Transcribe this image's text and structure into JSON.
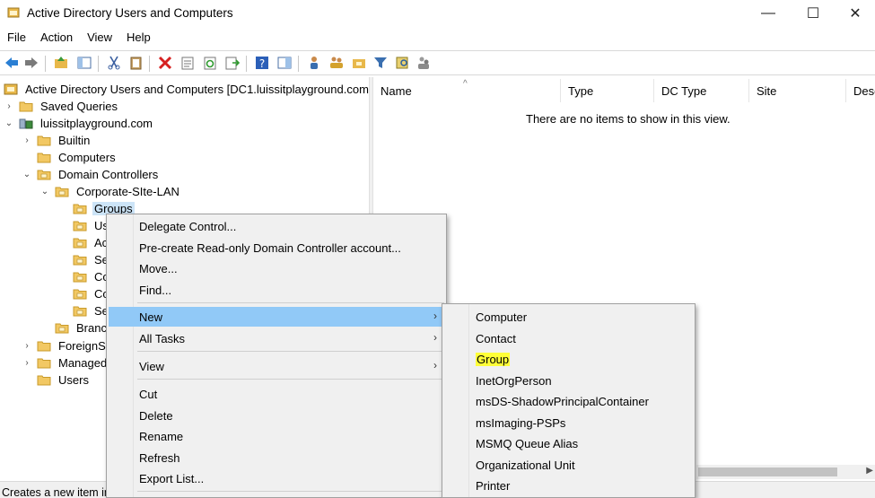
{
  "window": {
    "title": "Active Directory Users and Computers",
    "minimize": "—",
    "maximize": "☐",
    "close": "✕"
  },
  "menubar": [
    "File",
    "Action",
    "View",
    "Help"
  ],
  "tree": {
    "root": "Active Directory Users and Computers [DC1.luissitplayground.com]",
    "saved_queries": "Saved Queries",
    "domain": "luissitplayground.com",
    "builtin": "Builtin",
    "computers": "Computers",
    "domain_controllers": "Domain Controllers",
    "corporate_site": "Corporate-SIte-LAN",
    "groups": "Groups",
    "child_u": "Us",
    "child_a": "Ac",
    "child_s1": "Se",
    "child_c1": "Co",
    "child_c2": "Co",
    "child_s2": "Se",
    "branch": "Branc",
    "foreign": "ForeignSe",
    "managed": "Managed",
    "users": "Users"
  },
  "list": {
    "columns": [
      "Name",
      "Type",
      "DC Type",
      "Site",
      "Desc"
    ],
    "empty_message": "There are no items to show in this view.",
    "sort_glyph": "^"
  },
  "status": "Creates a new item in",
  "context_menu": {
    "items": [
      "Delegate Control...",
      "Pre-create Read-only Domain Controller account...",
      "Move...",
      "Find...",
      "New",
      "All Tasks",
      "View",
      "Cut",
      "Delete",
      "Rename",
      "Refresh",
      "Export List..."
    ],
    "submenu_arrow": "›"
  },
  "new_submenu": {
    "items": [
      "Computer",
      "Contact",
      "Group",
      "InetOrgPerson",
      "msDS-ShadowPrincipalContainer",
      "msImaging-PSPs",
      "MSMQ Queue Alias",
      "Organizational Unit",
      "Printer"
    ],
    "highlighted": "Group"
  },
  "colors": {
    "accent_highlight": "#91c9f7",
    "text_highlight": "#ffff38",
    "selected_node": "#cce4f7",
    "folder": "#e8b84a"
  }
}
